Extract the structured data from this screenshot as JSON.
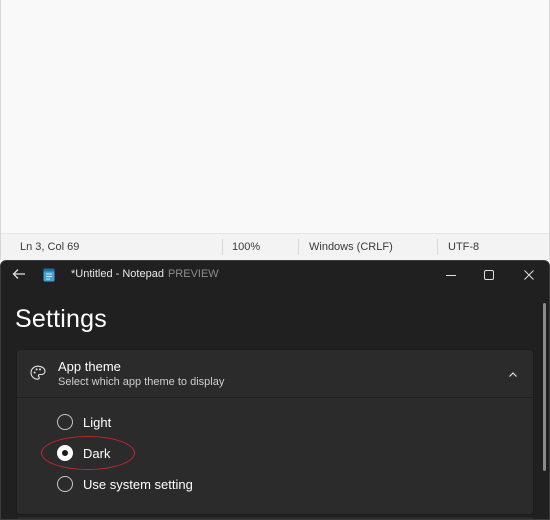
{
  "back_window": {
    "status_bar": {
      "position": "Ln 3, Col 69",
      "zoom": "100%",
      "line_ending": "Windows (CRLF)",
      "encoding": "UTF-8"
    }
  },
  "front_window": {
    "title": "*Untitled - Notepad",
    "preview_badge": "PREVIEW",
    "page_title": "Settings",
    "app_theme": {
      "title": "App theme",
      "subtitle": "Select which app theme to display",
      "options": [
        {
          "label": "Light",
          "selected": false
        },
        {
          "label": "Dark",
          "selected": true
        },
        {
          "label": "Use system setting",
          "selected": false
        }
      ]
    }
  },
  "colors": {
    "dark_bg": "#202020",
    "card_bg": "#2b2b2b",
    "highlight": "#c0262d",
    "light_bg": "#f9f9f9"
  }
}
